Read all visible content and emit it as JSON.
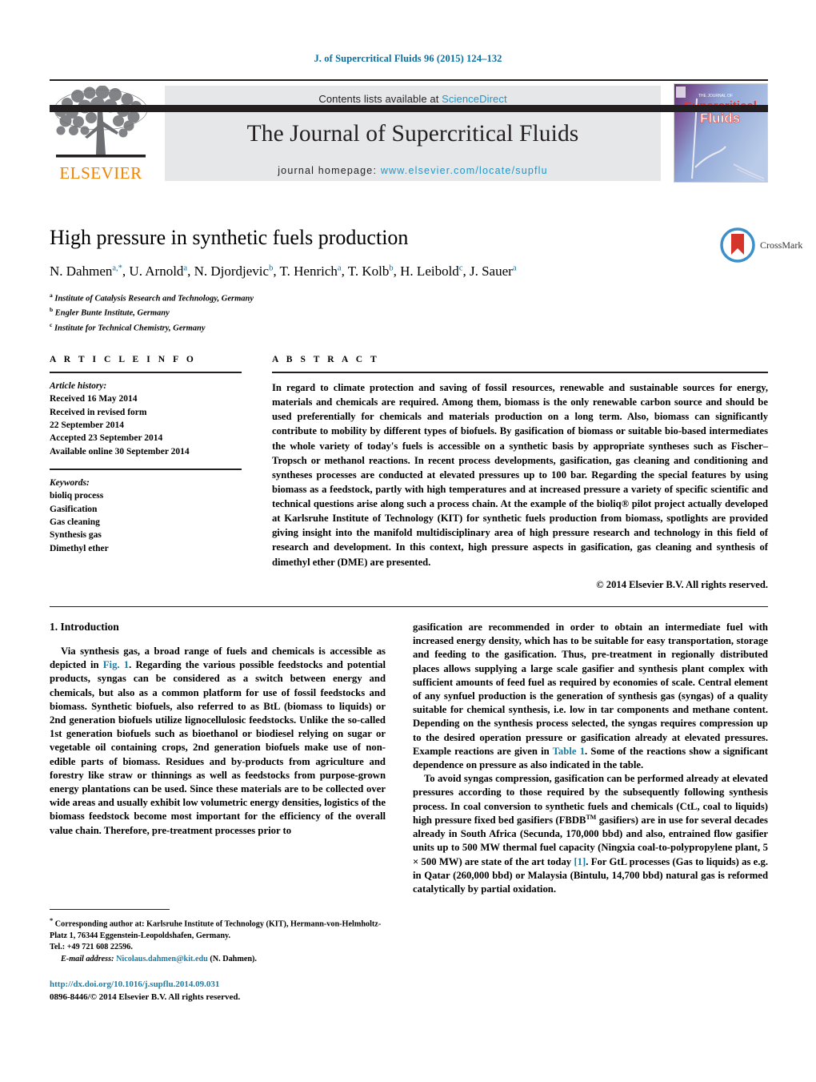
{
  "running_head": "J. of Supercritical Fluids 96 (2015) 124–132",
  "masthead": {
    "publisher_name": "ELSEVIER",
    "contents_prefix": "Contents lists available at ",
    "contents_link": "ScienceDirect",
    "journal_title": "The Journal of Supercritical Fluids",
    "homepage_prefix": "journal homepage: ",
    "homepage_url": "www.elsevier.com/locate/supflu",
    "cover_line1": "THE JOURNAL OF",
    "cover_line2": "Supercritical",
    "cover_line3": "Fluids"
  },
  "colors": {
    "link_blue": "#2196c9",
    "head_blue": "#0a6e9e",
    "elsevier_orange": "#ef8200",
    "band_gray": "#e6e7e8",
    "rule_black": "#231f20",
    "crossmark_red": "#d4342a",
    "crossmark_blue": "#3d8fc9"
  },
  "title": "High pressure in synthetic fuels production",
  "authors": [
    {
      "name": "N. Dahmen",
      "marks": "a,*"
    },
    {
      "name": "U. Arnold",
      "marks": "a"
    },
    {
      "name": "N. Djordjevic",
      "marks": "b"
    },
    {
      "name": "T. Henrich",
      "marks": "a"
    },
    {
      "name": "T. Kolb",
      "marks": "b"
    },
    {
      "name": "H. Leibold",
      "marks": "c"
    },
    {
      "name": "J. Sauer",
      "marks": "a"
    }
  ],
  "affiliations": [
    {
      "mark": "a",
      "text": "Institute of Catalysis Research and Technology, Germany"
    },
    {
      "mark": "b",
      "text": "Engler Bunte Institute, Germany"
    },
    {
      "mark": "c",
      "text": "Institute for Technical Chemistry, Germany"
    }
  ],
  "crossmark": {
    "label": "CrossMark"
  },
  "article_info": {
    "heading": "A R T I C L E   I N F O",
    "history_label": "Article history:",
    "history_lines": [
      "Received 16 May 2014",
      "Received in revised form",
      "22 September 2014",
      "Accepted 23 September 2014",
      "Available online 30 September 2014"
    ],
    "keywords_label": "Keywords:",
    "keywords": [
      "bioliq process",
      "Gasification",
      "Gas cleaning",
      "Synthesis gas",
      "Dimethyl ether"
    ]
  },
  "abstract": {
    "heading": "A B S T R A C T",
    "text": "In regard to climate protection and saving of fossil resources, renewable and sustainable sources for energy, materials and chemicals are required. Among them, biomass is the only renewable carbon source and should be used preferentially for chemicals and materials production on a long term. Also, biomass can significantly contribute to mobility by different types of biofuels. By gasification of biomass or suitable bio-based intermediates the whole variety of today's fuels is accessible on a synthetic basis by appropriate syntheses such as Fischer–Tropsch or methanol reactions. In recent process developments, gasification, gas cleaning and conditioning and syntheses processes are conducted at elevated pressures up to 100 bar. Regarding the special features by using biomass as a feedstock, partly with high temperatures and at increased pressure a variety of specific scientific and technical questions arise along such a process chain. At the example of the bioliq® pilot project actually developed at Karlsruhe Institute of Technology (KIT) for synthetic fuels production from biomass, spotlights are provided giving insight into the manifold multidisciplinary area of high pressure research and technology in this field of research and development. In this context, high pressure aspects in gasification, gas cleaning and synthesis of dimethyl ether (DME) are presented.",
    "copyright": "© 2014 Elsevier B.V. All rights reserved."
  },
  "body": {
    "section_heading": "1.  Introduction",
    "left_para_1a": "Via synthesis gas, a broad range of fuels and chemicals is accessible as depicted in ",
    "left_para_1_figref": "Fig. 1",
    "left_para_1b": ". Regarding the various possible feedstocks and potential products, syngas can be considered as a switch between energy and chemicals, but also as a common platform for use of fossil feedstocks and biomass. Synthetic biofuels, also referred to as BtL (biomass to liquids) or 2nd generation biofuels utilize lignocellulosic feedstocks. Unlike the so-called 1st generation biofuels such as bioethanol or biodiesel relying on sugar or vegetable oil containing crops, 2nd generation biofuels make use of non-edible parts of biomass. Residues and by-products from agriculture and forestry like straw or thinnings as well as feedstocks from purpose-grown energy plantations can be used. Since these materials are to be collected over wide areas and usually exhibit low volumetric energy densities, logistics of the biomass feedstock become most important for the efficiency of the overall value chain. Therefore, pre-treatment processes prior to",
    "right_para_1a": "gasification are recommended in order to obtain an intermediate fuel with increased energy density, which has to be suitable for easy transportation, storage and feeding to the gasification. Thus, pre-treatment in regionally distributed places allows supplying a large scale gasifier and synthesis plant complex with sufficient amounts of feed fuel as required by economies of scale. Central element of any synfuel production is the generation of synthesis gas (syngas) of a quality suitable for chemical synthesis, i.e. low in tar components and methane content. Depending on the synthesis process selected, the syngas requires compression up to the desired operation pressure or gasification already at elevated pressures. Example reactions are given in ",
    "right_para_1_tableref": "Table 1",
    "right_para_1b": ". Some of the reactions show a significant dependence on pressure as also indicated in the table.",
    "right_para_2a": "To avoid syngas compression, gasification can be performed already at elevated pressures according to those required by the subsequently following synthesis process. In coal conversion to synthetic fuels and chemicals (CtL, coal to liquids) high pressure fixed bed gasifiers (FBDB",
    "right_para_2_tm": "TM",
    "right_para_2b": " gasifiers) are in use for several decades already in South Africa (Secunda, 170,000 bbd) and also, entrained flow gasifier units up to 500 MW thermal fuel capacity (Ningxia coal-to-polypropylene plant, 5 × 500 MW) are state of the art today ",
    "right_para_2_ref": "[1]",
    "right_para_2c": ". For GtL processes (Gas to liquids) as e.g. in Qatar (260,000 bbd) or Malaysia (Bintulu, 14,700 bbd) natural gas is reformed catalytically by partial oxidation."
  },
  "footnote": {
    "star": "*",
    "corresponding": " Corresponding author at: Karlsruhe Institute of Technology (KIT), Hermann-von-Helmholtz-Platz 1, 76344 Eggenstein-Leopoldshafen, Germany.",
    "tel": "Tel.: +49 721 608 22596.",
    "email_label": "E-mail address:",
    "email": "Nicolaus.dahmen@kit.edu",
    "email_suffix": " (N. Dahmen)."
  },
  "doi": {
    "url": "http://dx.doi.org/10.1016/j.supflu.2014.09.031",
    "issn_line": "0896-8446/© 2014 Elsevier B.V. All rights reserved."
  }
}
